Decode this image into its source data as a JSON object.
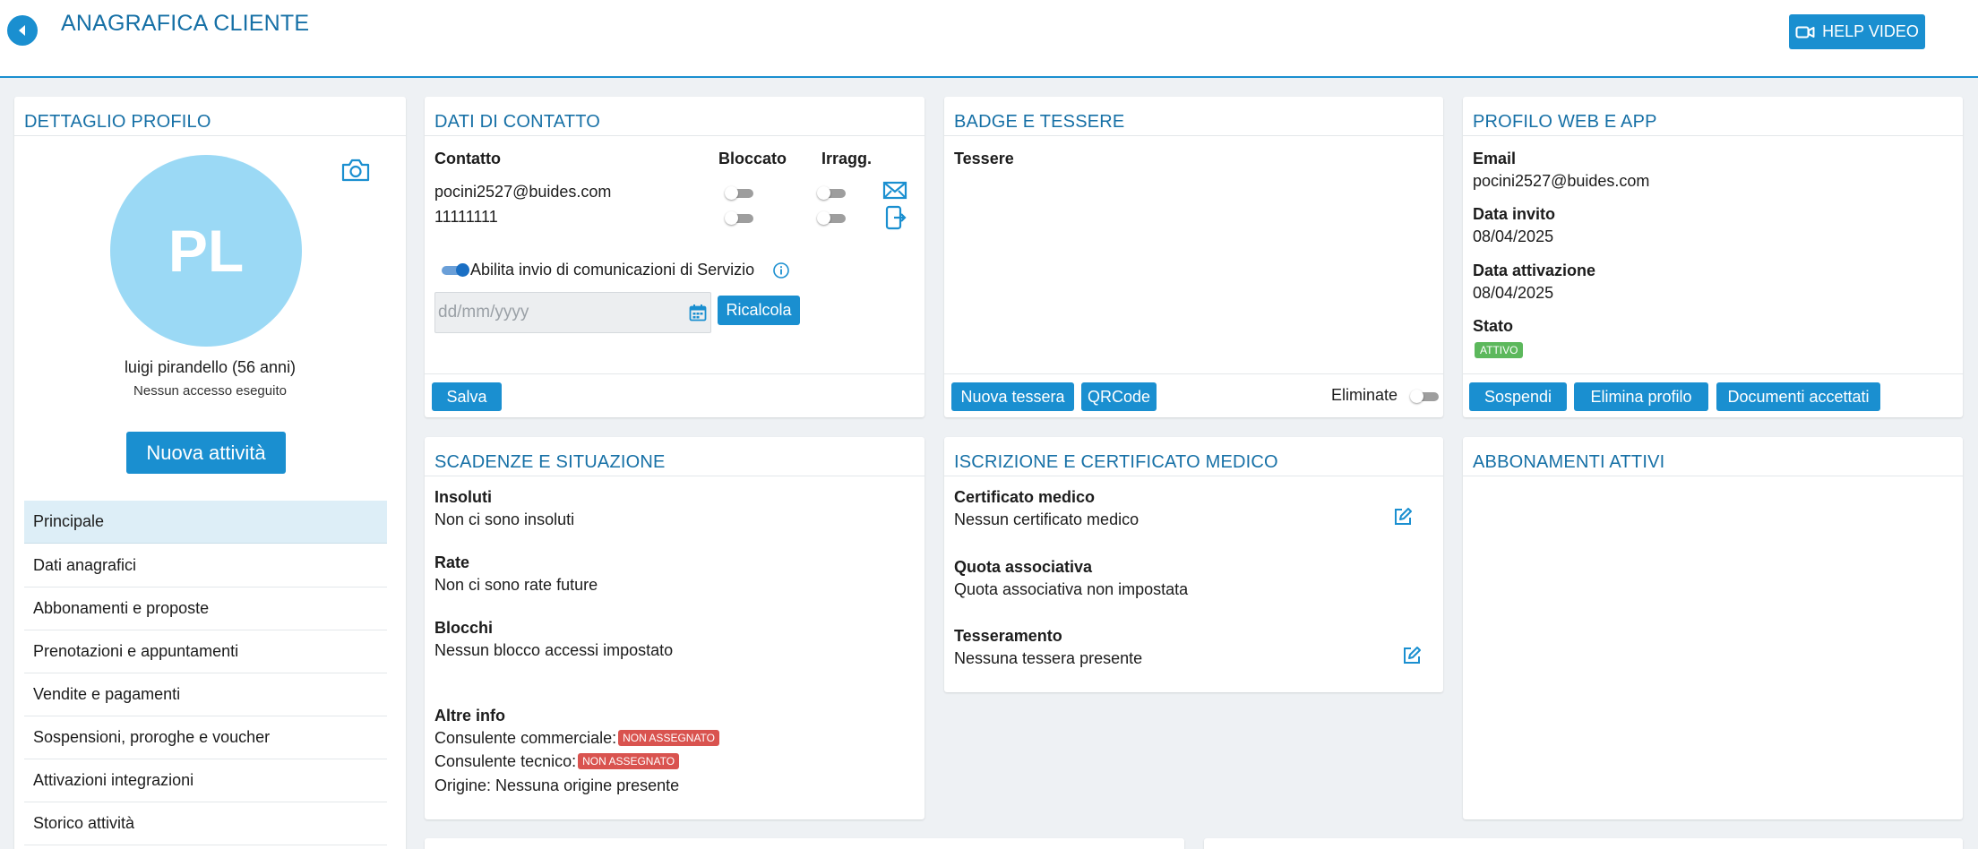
{
  "header": {
    "title": "ANAGRAFICA CLIENTE",
    "help_label": "HELP VIDEO"
  },
  "profile": {
    "title": "DETTAGLIO PROFILO",
    "initials": "PL",
    "avatar_color": "#9bd9f5",
    "name": "luigi pirandello (56 anni)",
    "access": "Nessun accesso eseguito",
    "new_activity": "Nuova attività",
    "nav": [
      "Principale",
      "Dati anagrafici",
      "Abbonamenti e proposte",
      "Prenotazioni e appuntamenti",
      "Vendite e pagamenti",
      "Sospensioni, proroghe e voucher",
      "Attivazioni integrazioni",
      "Storico attività"
    ]
  },
  "contact": {
    "title": "DATI DI CONTATTO",
    "col_contact": "Contatto",
    "col_blocked": "Bloccato",
    "col_reach": "Irragg.",
    "email": "pocini2527@buides.com",
    "phone": "11111111",
    "service_label": "Abilita invio di comunicazioni di Servizio",
    "date_placeholder": "dd/mm/yyyy",
    "recalc": "Ricalcola",
    "save": "Salva"
  },
  "badges": {
    "title": "BADGE E TESSERE",
    "cards_label": "Tessere",
    "new_card": "Nuova tessera",
    "qrcode": "QRCode",
    "deleted": "Eliminate"
  },
  "web": {
    "title": "PROFILO WEB E APP",
    "email_label": "Email",
    "email": "pocini2527@buides.com",
    "invite_label": "Data invito",
    "invite_date": "08/04/2025",
    "activation_label": "Data attivazione",
    "activation_date": "08/04/2025",
    "status_label": "Stato",
    "status": "ATTIVO",
    "suspend": "Sospendi",
    "delete_profile": "Elimina profilo",
    "docs": "Documenti accettati"
  },
  "deadlines": {
    "title": "SCADENZE E SITUAZIONE",
    "unpaid_label": "Insoluti",
    "unpaid": "Non ci sono insoluti",
    "rates_label": "Rate",
    "rates": "Non ci sono rate future",
    "blocks_label": "Blocchi",
    "blocks": "Nessun blocco accessi impostato",
    "other_label": "Altre info",
    "commercial": "Consulente commerciale:",
    "technical": "Consulente tecnico:",
    "unassigned": "NON ASSEGNATO",
    "origin": "Origine: Nessuna origine presente"
  },
  "enrollment": {
    "title": "ISCRIZIONE E CERTIFICATO MEDICO",
    "cert_label": "Certificato medico",
    "cert": "Nessun certificato medico",
    "fee_label": "Quota associativa",
    "fee": "Quota associativa non impostata",
    "membership_label": "Tesseramento",
    "membership": "Nessuna tessera presente"
  },
  "subscriptions": {
    "title": "ABBONAMENTI ATTIVI"
  }
}
